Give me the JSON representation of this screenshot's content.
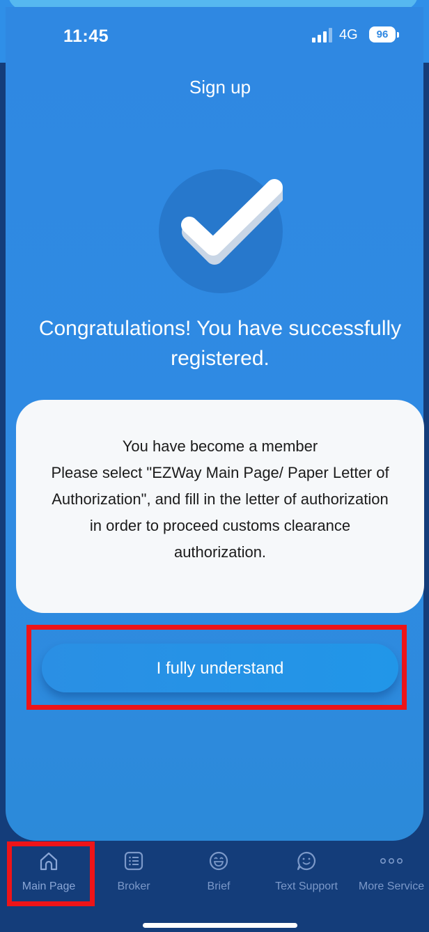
{
  "status_bar": {
    "time": "11:45",
    "network": "4G",
    "battery": "96"
  },
  "header": {
    "title": "Sign up"
  },
  "success": {
    "message": "Congratulations! You have successfully registered."
  },
  "info_card": {
    "lines": [
      "You have become a member",
      "Please select \"EZWay Main Page/ Paper Letter of",
      "Authorization\", and fill in the letter of authorization",
      "in order to proceed customs clearance",
      "authorization."
    ]
  },
  "actions": {
    "confirm_label": "I fully understand"
  },
  "tabbar": {
    "tabs": [
      {
        "label": "Main Page",
        "icon": "home-icon",
        "active": true
      },
      {
        "label": "Broker",
        "icon": "list-icon",
        "active": false
      },
      {
        "label": "Brief",
        "icon": "smile-face-icon",
        "active": false
      },
      {
        "label": "Text Support",
        "icon": "chat-smile-icon",
        "active": false
      },
      {
        "label": "More Service",
        "icon": "more-dots-icon",
        "active": false
      }
    ]
  },
  "colors": {
    "primary_blue": "#2f88e2",
    "nav_background": "#143d7a",
    "highlight_red": "#ee1418",
    "card_background": "#f6f8fa"
  }
}
